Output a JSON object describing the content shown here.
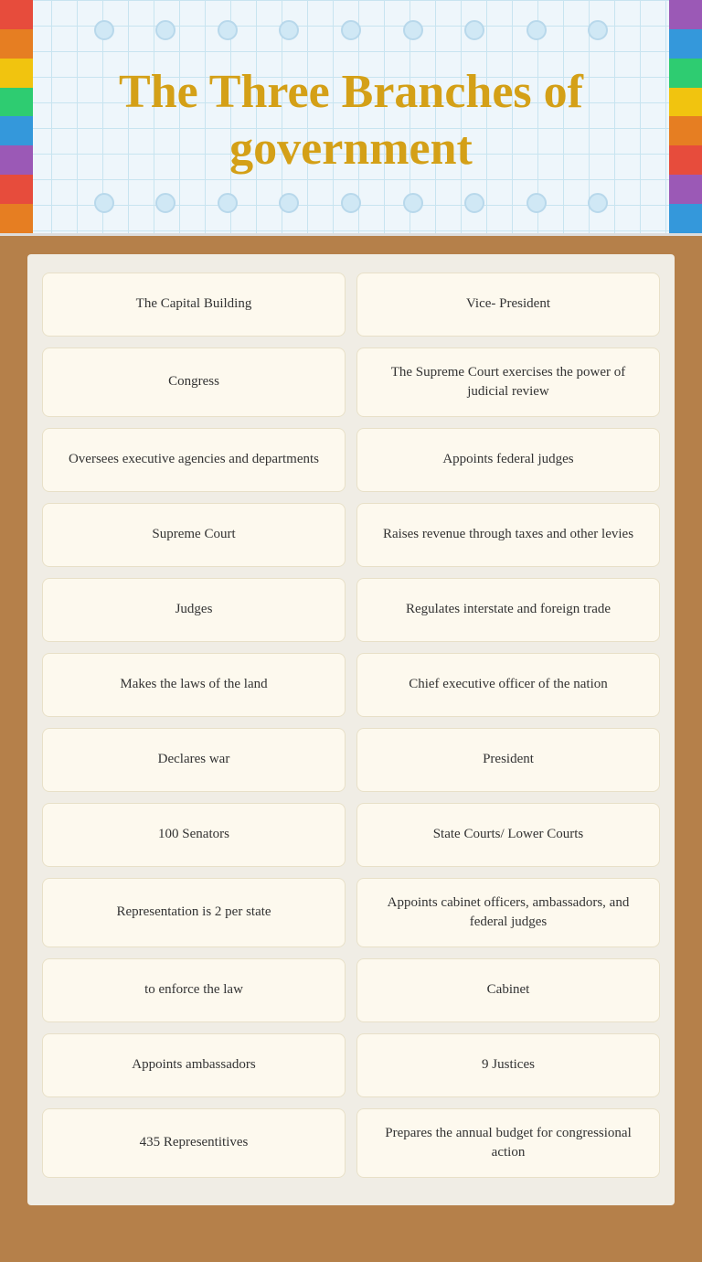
{
  "header": {
    "title": "The Three Branches of government"
  },
  "cards": [
    {
      "id": 1,
      "text": "The Capital Building"
    },
    {
      "id": 2,
      "text": "Vice- President"
    },
    {
      "id": 3,
      "text": "Congress"
    },
    {
      "id": 4,
      "text": "The Supreme Court exercises the power of judicial review"
    },
    {
      "id": 5,
      "text": "Oversees executive agencies and departments"
    },
    {
      "id": 6,
      "text": "Appoints federal judges"
    },
    {
      "id": 7,
      "text": "Supreme Court"
    },
    {
      "id": 8,
      "text": "Raises revenue through taxes and other levies"
    },
    {
      "id": 9,
      "text": "Judges"
    },
    {
      "id": 10,
      "text": "Regulates interstate and foreign trade"
    },
    {
      "id": 11,
      "text": "Makes the laws of the land"
    },
    {
      "id": 12,
      "text": "Chief executive officer of the nation"
    },
    {
      "id": 13,
      "text": "Declares war"
    },
    {
      "id": 14,
      "text": "President"
    },
    {
      "id": 15,
      "text": "100 Senators"
    },
    {
      "id": 16,
      "text": "State Courts/ Lower Courts"
    },
    {
      "id": 17,
      "text": "Representation is 2 per state"
    },
    {
      "id": 18,
      "text": "Appoints cabinet officers, ambassadors, and federal judges"
    },
    {
      "id": 19,
      "text": "to enforce the law"
    },
    {
      "id": 20,
      "text": "Cabinet"
    },
    {
      "id": 21,
      "text": "Appoints ambassadors"
    },
    {
      "id": 22,
      "text": "9 Justices"
    },
    {
      "id": 23,
      "text": "435 Representitives"
    },
    {
      "id": 24,
      "text": "Prepares the annual budget for congressional action"
    }
  ],
  "colors": {
    "title": "#d4a017",
    "card_bg": "#fdf9ee",
    "card_border": "#e8e0c8",
    "main_bg": "#f0ede5",
    "body_bg": "#b5804a",
    "header_bg": "#eef6fb",
    "header_grid": "#c8e4f0",
    "strip_colors": [
      "#e74c3c",
      "#e67e22",
      "#f1c40f",
      "#2ecc71",
      "#3498db",
      "#9b59b6"
    ]
  }
}
